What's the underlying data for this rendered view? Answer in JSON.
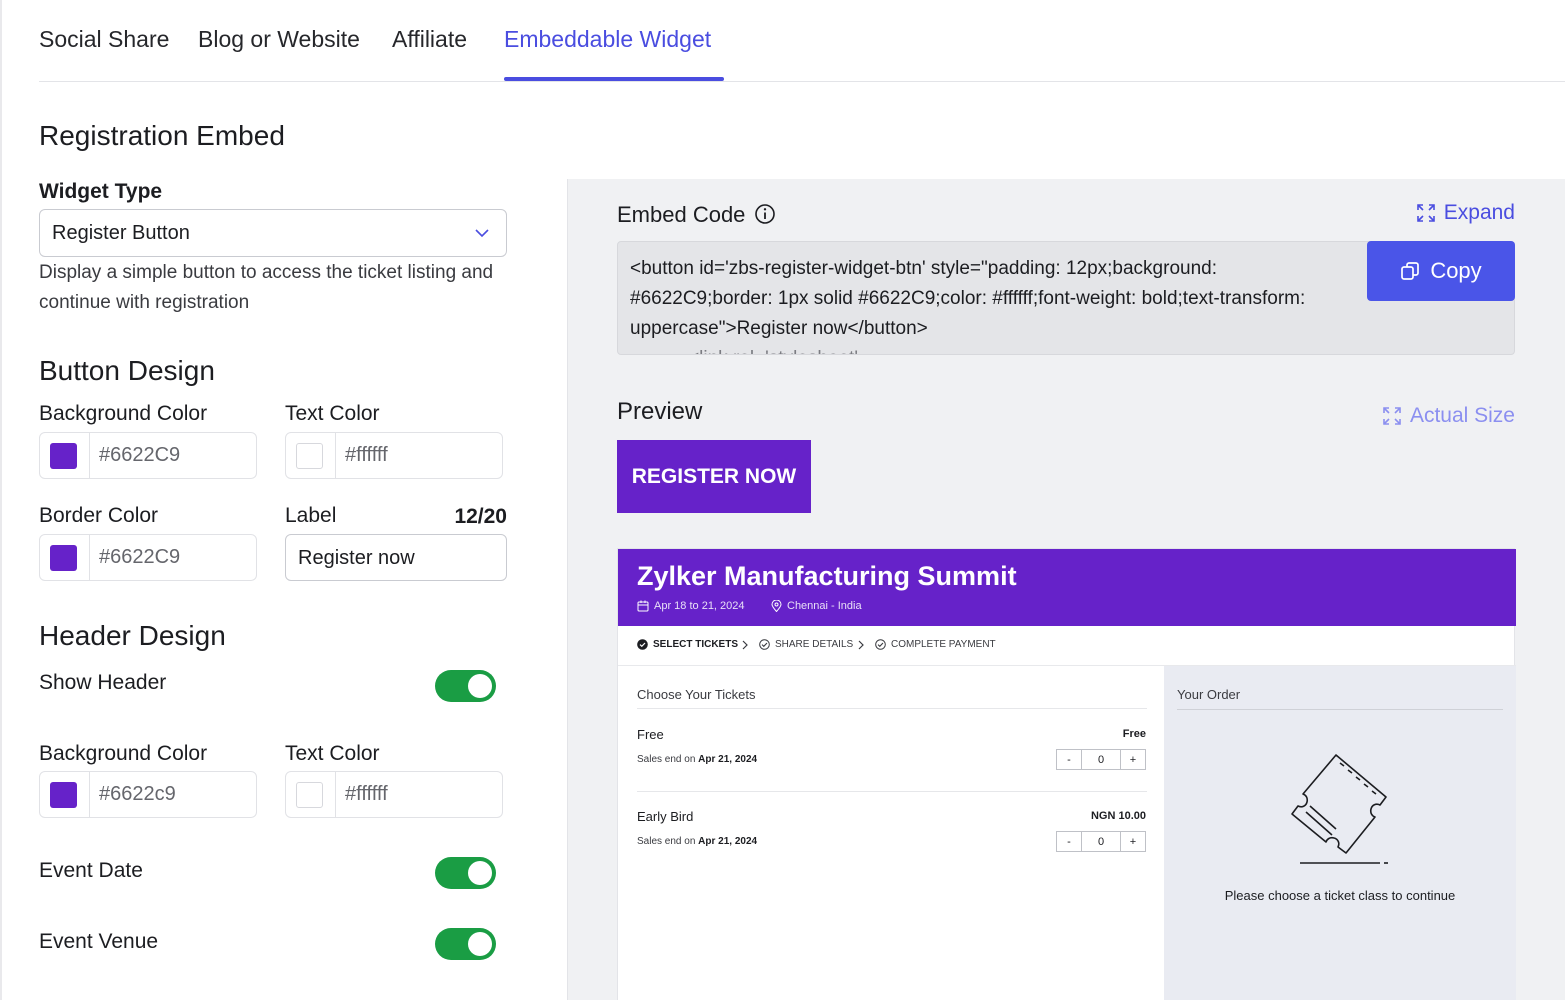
{
  "tabs": [
    {
      "label": "Social Share"
    },
    {
      "label": "Blog or Website"
    },
    {
      "label": "Affiliate"
    },
    {
      "label": "Embeddable Widget"
    }
  ],
  "active_tab": "Embeddable Widget",
  "accent_color": "#4a4de0",
  "registration": {
    "title": "Registration Embed",
    "widget_type_label": "Widget Type",
    "widget_type_value": "Register Button",
    "widget_type_help": "Display a simple button to access the ticket listing and continue with registration"
  },
  "button_design": {
    "title": "Button Design",
    "bg_color_label": "Background Color",
    "bg_color_value": "#6622C9",
    "text_color_label": "Text Color",
    "text_color_value": "#ffffff",
    "border_color_label": "Border Color",
    "border_color_value": "#6622C9",
    "label_label": "Label",
    "label_counter": "12/20",
    "label_value": "Register now"
  },
  "header_design": {
    "title": "Header Design",
    "show_header_label": "Show Header",
    "show_header_on": true,
    "bg_color_label": "Background Color",
    "bg_color_value": "#6622c9",
    "text_color_label": "Text Color",
    "text_color_value": "#ffffff",
    "event_date_label": "Event Date",
    "event_date_on": true,
    "event_venue_label": "Event Venue",
    "event_venue_on": true
  },
  "embed": {
    "title": "Embed Code",
    "expand_label": "Expand",
    "copy_label": "Copy",
    "code": "<button id='zbs-register-widget-btn' style=\"padding: 12px;background: #6622C9;border: 1px solid #6622C9;color: #ffffff;font-weight: bold;text-transform: uppercase\">Register now</button>",
    "code_cut_line": "...........<link rel='stylesheet'"
  },
  "preview": {
    "title": "Preview",
    "actual_size_label": "Actual Size",
    "button_label": "REGISTER NOW"
  },
  "widget": {
    "event_title": "Zylker Manufacturing Summit",
    "date": "Apr 18 to 21, 2024",
    "venue": "Chennai - India",
    "steps": [
      "SELECT TICKETS",
      "SHARE DETAILS",
      "COMPLETE PAYMENT"
    ],
    "choose_label": "Choose Your Tickets",
    "tickets": [
      {
        "name": "Free",
        "price": "Free",
        "sales_prefix": "Sales end on",
        "sales_date": "Apr 21, 2024",
        "qty": "0"
      },
      {
        "name": "Early Bird",
        "price": "NGN 10.00",
        "sales_prefix": "Sales end on",
        "sales_date": "Apr 21, 2024",
        "qty": "0"
      }
    ],
    "stepper_minus": "-",
    "stepper_plus": "+",
    "order_title": "Your Order",
    "order_empty_message": "Please choose a ticket class to continue"
  }
}
